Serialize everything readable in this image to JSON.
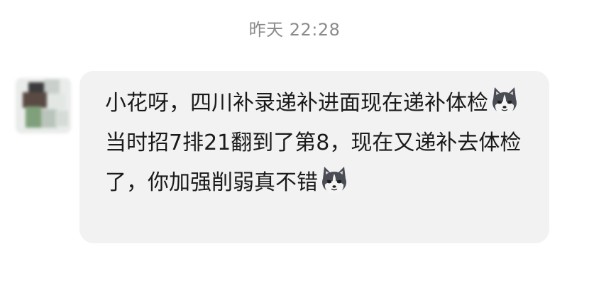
{
  "chat": {
    "timestamp": "昨天 22:28",
    "message": {
      "segments": [
        {
          "type": "text",
          "value": "小花呀，四川补录递补进面现在递补体检"
        },
        {
          "type": "emoji",
          "icon": "husky-dog-emoji"
        },
        {
          "type": "text",
          "value": "当时招7排21翻到了第8，现在又递补去体检了，你加强削弱真不错"
        },
        {
          "type": "emoji",
          "icon": "husky-dog-emoji"
        }
      ]
    }
  },
  "colors": {
    "background": "#ffffff",
    "bubble": "#f2f2f2",
    "text": "#1a1a1a",
    "timestamp": "#8a8a8a"
  }
}
